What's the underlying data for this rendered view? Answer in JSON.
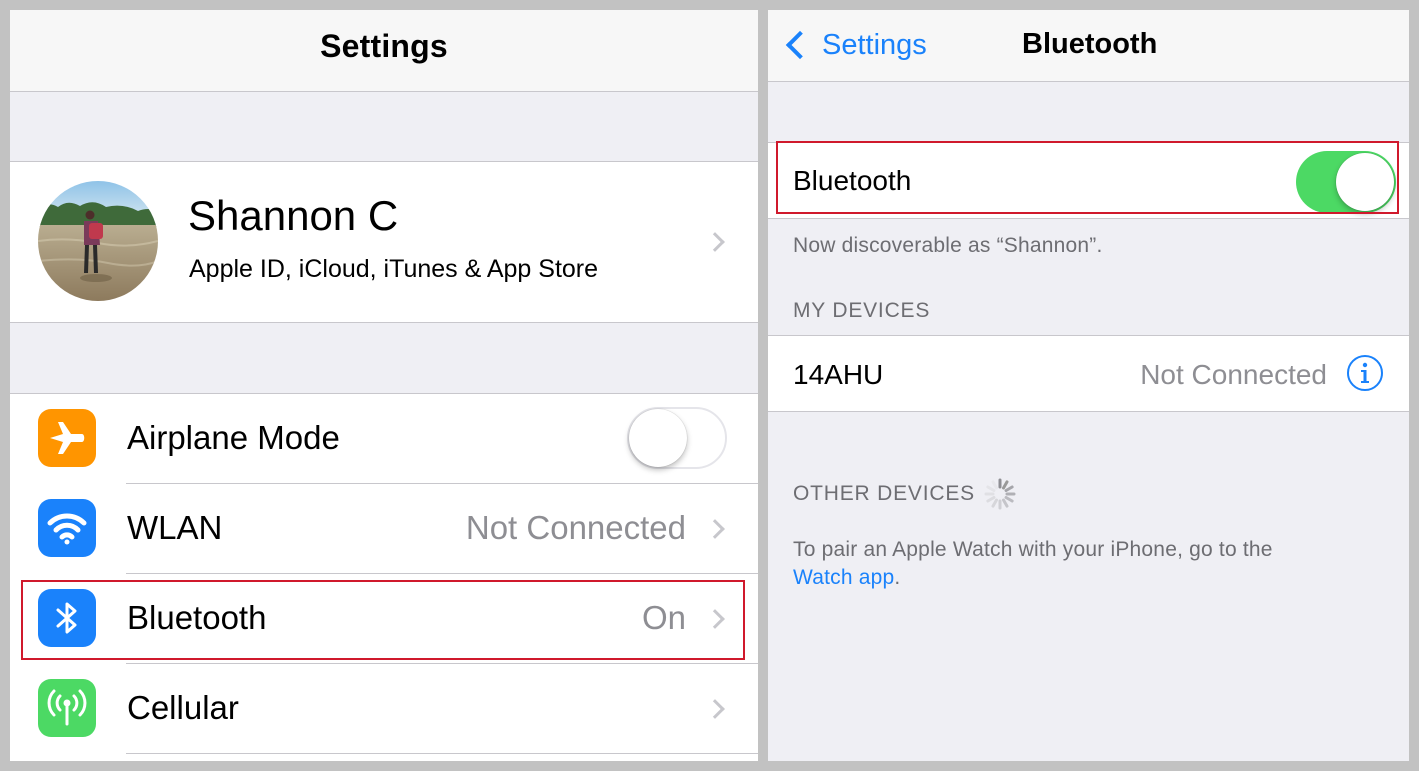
{
  "left_screen": {
    "title": "Settings",
    "profile": {
      "name": "Shannon C",
      "subtitle": "Apple ID, iCloud, iTunes & App Store"
    },
    "rows": [
      {
        "label": "Airplane Mode",
        "value": "",
        "icon": "airplane-icon",
        "icon_color": "#ff9500",
        "toggle_on": false
      },
      {
        "label": "WLAN",
        "value": "Not Connected",
        "icon": "wifi-icon",
        "icon_color": "#1a82fb"
      },
      {
        "label": "Bluetooth",
        "value": "On",
        "icon": "bluetooth-icon",
        "icon_color": "#1a82fb",
        "highlighted": true
      },
      {
        "label": "Cellular",
        "value": "",
        "icon": "cellular-antenna-icon",
        "icon_color": "#4cd964"
      }
    ]
  },
  "right_screen": {
    "back_label": "Settings",
    "title": "Bluetooth",
    "bluetooth_row": {
      "label": "Bluetooth",
      "toggle_on": true,
      "highlighted": true
    },
    "discoverable_text": "Now discoverable as “Shannon”.",
    "my_devices_header": "MY DEVICES",
    "devices": [
      {
        "name": "14AHU",
        "status": "Not Connected"
      }
    ],
    "other_devices_header": "OTHER DEVICES",
    "pair_text": "To pair an Apple Watch with your iPhone, go to the",
    "pair_link": "Watch app",
    "pair_text_end": "."
  },
  "colors": {
    "accent_blue": "#1a82fb",
    "toggle_green": "#4cd964",
    "highlight_red": "#d0192c"
  }
}
